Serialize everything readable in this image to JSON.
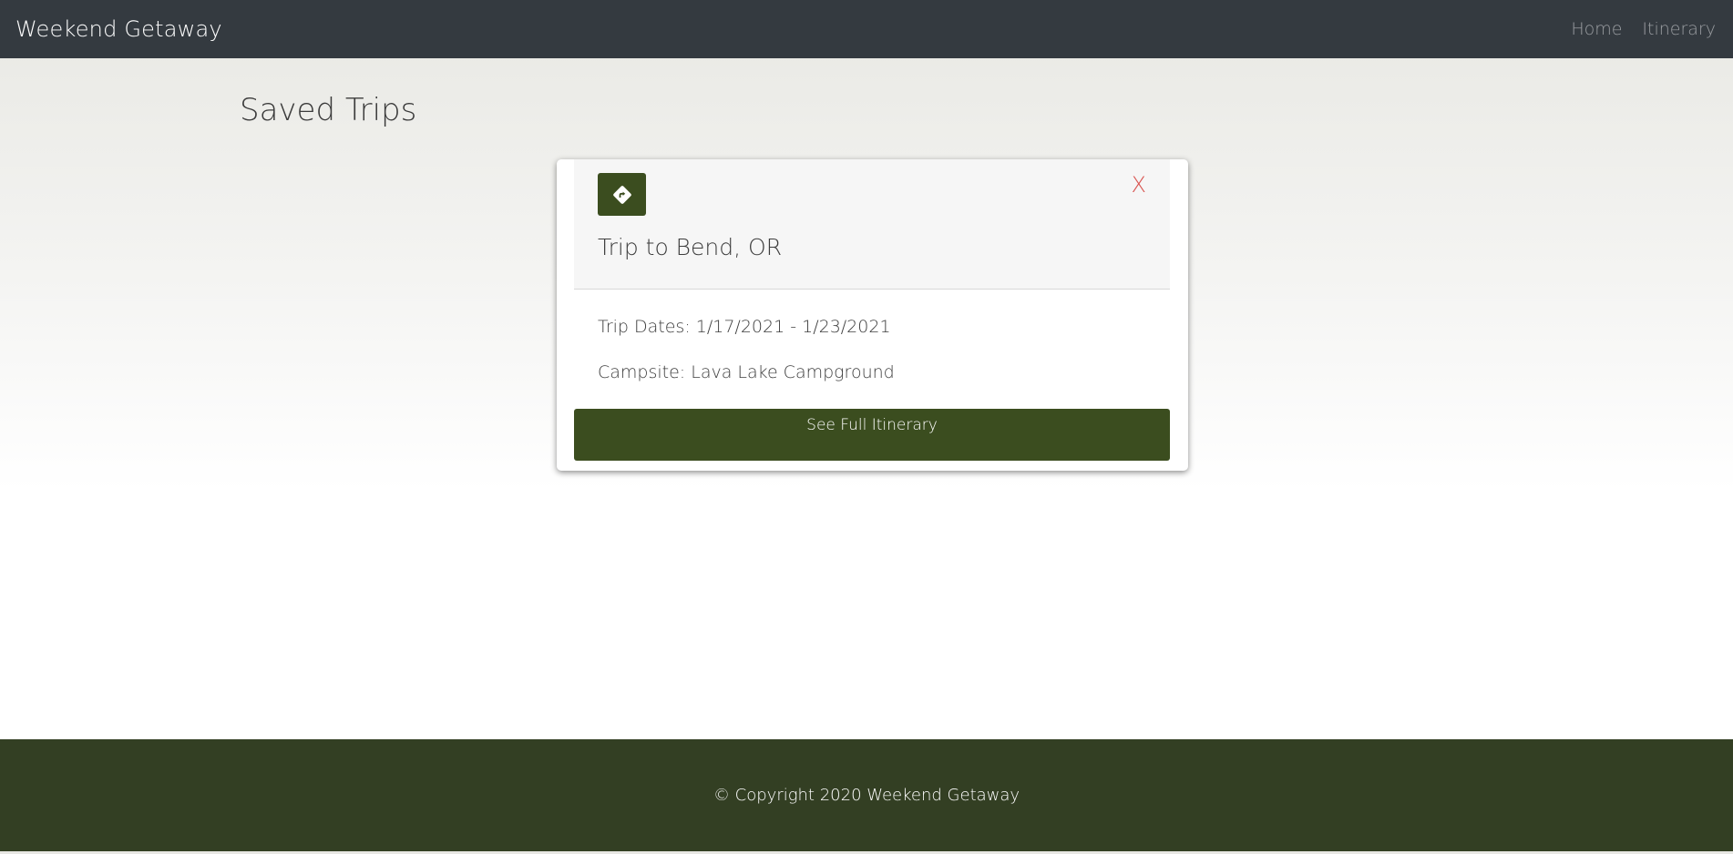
{
  "navbar": {
    "brand": "Weekend Getaway",
    "links": [
      {
        "label": "Home"
      },
      {
        "label": "Itinerary"
      }
    ]
  },
  "page": {
    "title": "Saved Trips"
  },
  "trip_card": {
    "icon": "directions-sign-icon",
    "close_label": "X",
    "title": "Trip to Bend, OR",
    "dates": "Trip Dates: 1/17/2021 - 1/23/2021",
    "campsite": "Campsite: Lava Lake Campground",
    "button_label": "See Full Itinerary"
  },
  "footer": {
    "text": "© Copyright 2020 Weekend Getaway"
  },
  "colors": {
    "navbar": "#343a40",
    "accent_green": "#3b4d1f",
    "footer_green": "#333f23",
    "close_red": "#d9534f"
  }
}
